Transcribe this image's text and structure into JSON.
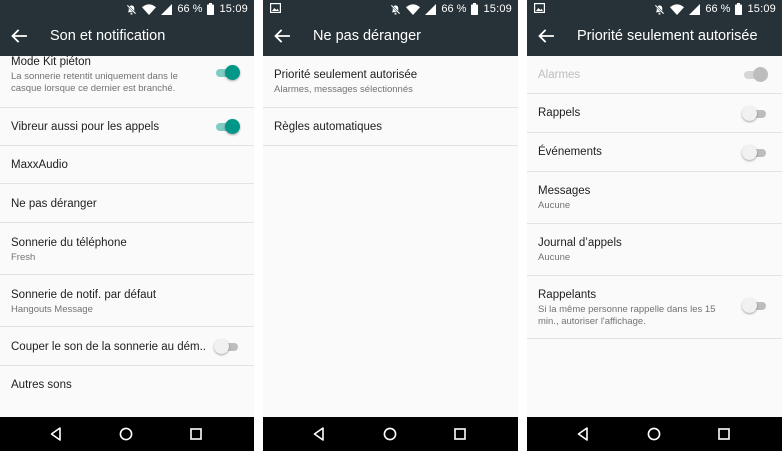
{
  "status_bar": {
    "battery_percent": "66 %",
    "time": "15:09"
  },
  "screens": [
    {
      "title": "Son et notification",
      "items": [
        {
          "title": "Mode Kit piéton",
          "subtitle": "La sonnerie retentit uniquement dans le casque lorsque ce dernier est branché."
        },
        {
          "title": "Vibreur aussi pour les appels"
        },
        {
          "title": "MaxxAudio"
        },
        {
          "title": "Ne pas déranger"
        },
        {
          "title": "Sonnerie du téléphone",
          "subtitle": "Fresh"
        },
        {
          "title": "Sonnerie de notif. par défaut",
          "subtitle": "Hangouts Message"
        },
        {
          "title": "Couper le son de la sonnerie au dém.."
        },
        {
          "title": "Autres sons"
        }
      ]
    },
    {
      "title": "Ne pas déranger",
      "items": [
        {
          "title": "Priorité seulement autorisée",
          "subtitle": "Alarmes, messages sélectionnés"
        },
        {
          "title": "Règles automatiques"
        }
      ]
    },
    {
      "title": "Priorité seulement autorisée",
      "items": [
        {
          "title": "Alarmes"
        },
        {
          "title": "Rappels"
        },
        {
          "title": "Événements"
        },
        {
          "title": "Messages",
          "subtitle": "Aucune"
        },
        {
          "title": "Journal d’appels",
          "subtitle": "Aucune"
        },
        {
          "title": "Rappelants",
          "subtitle": "Si la même personne rappelle dans les 15 min., autoriser l'affichage."
        }
      ]
    }
  ],
  "toggles": {
    "mode_kit_pieton": true,
    "vibreur_appels": true,
    "couper_son_demarrage": false,
    "alarmes": true,
    "rappels": false,
    "evenements": false,
    "rappelants": false
  },
  "icons": {
    "status": [
      "dnd-icon",
      "wifi-icon",
      "signal-icon",
      "battery-icon",
      "image-notification-icon"
    ],
    "toolbar": "back-arrow-icon",
    "nav": [
      "nav-back-icon",
      "nav-home-icon",
      "nav-recents-icon"
    ]
  },
  "colors": {
    "toolbar": "#263238",
    "accent": "#009688",
    "background": "#fafafa",
    "navbar": "#000000"
  }
}
